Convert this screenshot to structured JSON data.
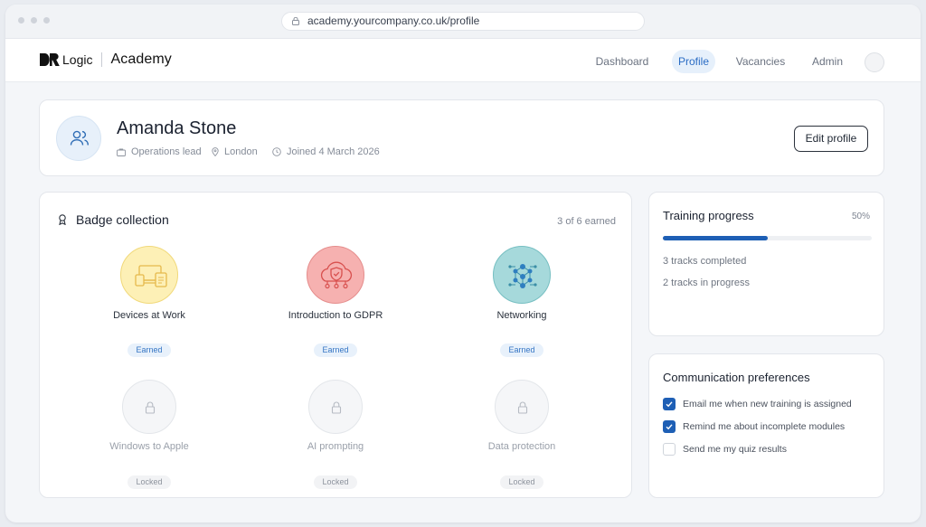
{
  "browser": {
    "url": "academy.yourcompany.co.uk/profile"
  },
  "brand": {
    "logo_mark": "DR",
    "logo_word": "Logic",
    "product": "Academy"
  },
  "nav": {
    "items": [
      {
        "label": "Dashboard",
        "active": false
      },
      {
        "label": "Profile",
        "active": true
      },
      {
        "label": "Vacancies",
        "active": false
      },
      {
        "label": "Admin",
        "active": false
      }
    ]
  },
  "profile": {
    "name": "Amanda Stone",
    "role": "Operations lead",
    "location": "London",
    "joined": "Joined 4 March 2026",
    "edit_label": "Edit profile"
  },
  "badges": {
    "title": "Badge collection",
    "count": "3 of 6 earned",
    "items": [
      {
        "name": "Devices at Work",
        "status": "Earned",
        "icon": "devices-icon",
        "color": "#fdf0b6"
      },
      {
        "name": "Introduction to GDPR",
        "status": "Earned",
        "icon": "shield-cloud-icon",
        "color": "#f6b1b0"
      },
      {
        "name": "Networking",
        "status": "Earned",
        "icon": "network-icon",
        "color": "#a6d9db"
      },
      {
        "name": "Windows to Apple",
        "status": "Locked",
        "icon": "lock-icon"
      },
      {
        "name": "AI prompting",
        "status": "Locked",
        "icon": "lock-icon"
      },
      {
        "name": "Data protection",
        "status": "Locked",
        "icon": "lock-icon"
      }
    ]
  },
  "training": {
    "title": "Training progress",
    "percent_label": "50%",
    "progress": 0.5,
    "completed": "3 tracks completed",
    "in_progress": "2 tracks in progress"
  },
  "communication": {
    "title": "Communication preferences",
    "options": [
      {
        "label": "Email me when new training is assigned",
        "checked": true
      },
      {
        "label": "Remind me about incomplete modules",
        "checked": true
      },
      {
        "label": "Send me my quiz results",
        "checked": false
      }
    ]
  },
  "colors": {
    "accent": "#1e5fb5",
    "nav_active_bg": "#e6f0fb"
  }
}
